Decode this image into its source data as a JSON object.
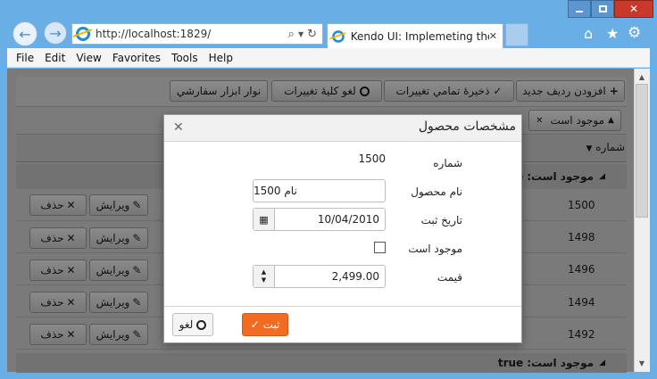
{
  "browser": {
    "address_url": "http://localhost:1829/",
    "address_host": "localhost",
    "tab_title": "Kendo UI: Implemeting the ...",
    "menu": [
      "File",
      "Edit",
      "View",
      "Favorites",
      "Tools",
      "Help"
    ],
    "icons": [
      "back-arrow-icon",
      "forward-arrow-icon",
      "ie-logo-icon",
      "search-icon",
      "refresh-icon",
      "close-icon",
      "home-icon",
      "star-icon",
      "gear-icon"
    ]
  },
  "grid": {
    "toolbar": {
      "add": "افزودن رديف جديد",
      "save_all": "ذخيرهٔ تمامي تغييرات",
      "cancel_all": "لغو كليهٔ تغييرات",
      "custom": "نوار ابزار سفارشي"
    },
    "group_chip": "موجود است",
    "id_header": "شماره",
    "group_prefix": "موجود است:",
    "group_false_suffix": "e",
    "group_true_value": "true",
    "rows": [
      {
        "id": "1500"
      },
      {
        "id": "1498"
      },
      {
        "id": "1496"
      },
      {
        "id": "1494"
      },
      {
        "id": "1492"
      }
    ],
    "edit_label": "ويرايش",
    "delete_label": "حذف"
  },
  "dialog": {
    "title": "مشخصات محصول",
    "fields": {
      "id_label": "شماره",
      "id_value": "1500",
      "name_label": "نام محصول",
      "name_value": "نام 1500",
      "date_label": "تاريخ ثبت",
      "date_value": "10/04/2010",
      "available_label": "موجود است",
      "available_checked": false,
      "price_label": "قيمت",
      "price_value": "2,499.00"
    },
    "save_label": "ثبت",
    "cancel_label": "لغو"
  },
  "colors": {
    "accent_orange": "#f36b21",
    "window_blue": "#6aaee6"
  }
}
